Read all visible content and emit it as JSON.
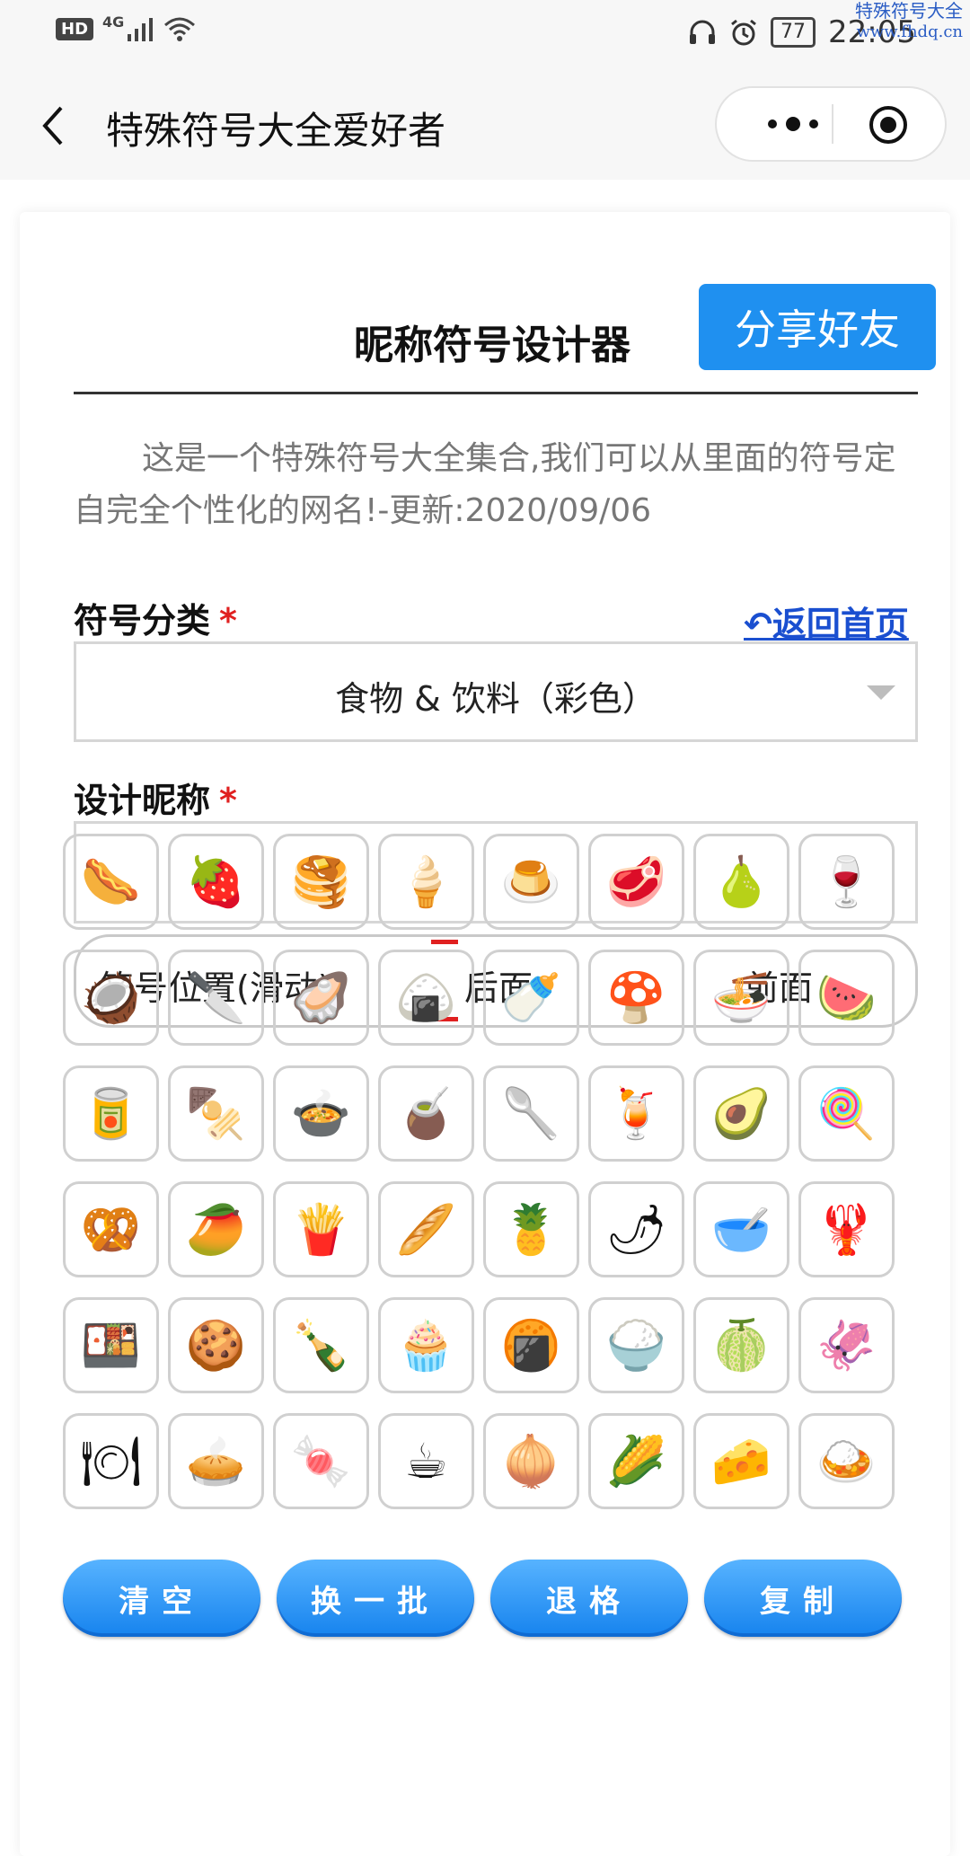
{
  "status_bar": {
    "hd": "HD",
    "network": "4G",
    "battery": "77",
    "time": "22:05",
    "watermark_line1": "特殊符号大全",
    "watermark_line2": "www.fhdq.cn"
  },
  "navbar": {
    "title": "特殊符号大全爱好者"
  },
  "card": {
    "title": "昵称符号设计器",
    "share_label": "分享好友",
    "intro": "这是一个特殊符号大全集合,我们可以从里面的符号定自完全个性化的网名!-更新:2020/09/06",
    "category_label": "符号分类",
    "required_mark": "*",
    "home_link": "↶返回首页",
    "category_value": "食物 & 饮料（彩色）",
    "nickname_label": "设计昵称",
    "nickname_value": "",
    "position": {
      "label": "符号位置(滑动)",
      "after": "后面",
      "before": "前面",
      "selected": "后面"
    }
  },
  "symbols": [
    "🌭",
    "🍓",
    "🥞",
    "🍦",
    "🍮",
    "🥩",
    "🍐",
    "🍷",
    "🥥",
    "🔪",
    "🦪",
    "🍙",
    "🍼",
    "🍄",
    "🍜",
    "🍉",
    "🥫",
    "🍢",
    "🍲",
    "🧉",
    "🥄",
    "🍹",
    "🥑",
    "🍭",
    "🥨",
    "🥭",
    "🍟",
    "🥖",
    "🍍",
    "🌶",
    "🥣",
    "🦞",
    "🍱",
    "🍪",
    "🍾",
    "🧁",
    "🍘",
    "🍚",
    "🍈",
    "🦑",
    "🍽",
    "🥧",
    "🍬",
    "☕",
    "🧅",
    "🌽",
    "🧀",
    "🍛"
  ],
  "actions": [
    "清空",
    "换一批",
    "退格",
    "复制"
  ],
  "colors": {
    "accent": "#1f90f0",
    "required": "#e02020",
    "link": "#1a4fd0"
  }
}
